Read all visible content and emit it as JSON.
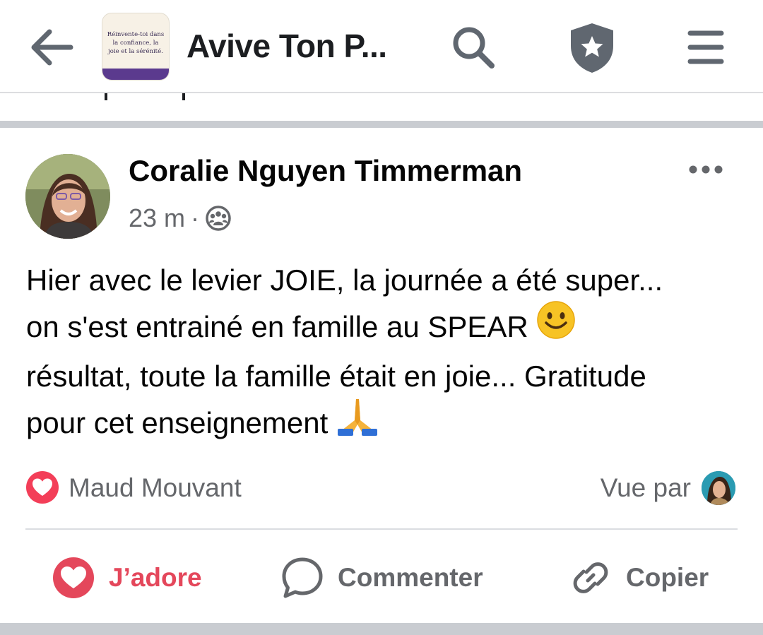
{
  "header": {
    "group_title": "Avive Ton P...",
    "thumb_text": "Réinvente-toi dans la confiance, la joie et la sérénité.",
    "icons": [
      "back-arrow-icon",
      "search-icon",
      "shield-star-icon",
      "hamburger-menu-icon"
    ]
  },
  "post": {
    "author": "Coralie Nguyen Timmerman",
    "time": "23 m",
    "separator": "·",
    "privacy_icon": "group-audience-icon",
    "text_parts": {
      "line1": "Hier avec le levier JOIE, la journée a été super...",
      "line2": "on s'est entrainé en famille au SPEAR ",
      "emoji_smile": "🙂",
      "line3": "résultat, toute la famille était en joie... Gratitude",
      "line4": "pour cet enseignement ",
      "emoji_pray": "🙏"
    },
    "reaction": {
      "icon": "love-reaction-icon",
      "reactor": "Maud Mouvant",
      "seen_by_label": "Vue par"
    },
    "actions": {
      "love": "J’adore",
      "comment": "Commenter",
      "copy": "Copier"
    }
  },
  "colors": {
    "love_red": "#e4475b",
    "secondary_text": "#65676b",
    "separator_grey": "#c9ccd1",
    "icon_grey": "#606770"
  }
}
